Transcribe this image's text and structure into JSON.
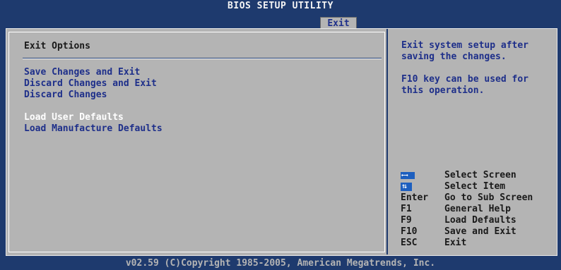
{
  "window": {
    "title": "BIOS SETUP UTILITY",
    "active_tab": "Exit"
  },
  "main": {
    "section_title": "Exit Options",
    "items": [
      {
        "label": "Save Changes and Exit"
      },
      {
        "label": "Discard Changes and Exit"
      },
      {
        "label": "Discard Changes"
      },
      {
        "label": "Load User Defaults",
        "selected": true
      },
      {
        "label": "Load Manufacture Defaults"
      }
    ]
  },
  "help": {
    "line1": "Exit system setup after saving the changes.",
    "line2": "F10 key can be used for this operation."
  },
  "keys": [
    {
      "key": "",
      "icon": "left-right-arrows-icon",
      "action": "Select Screen"
    },
    {
      "key": "",
      "icon": "up-down-arrows-icon",
      "action": "Select Item"
    },
    {
      "key": "Enter",
      "action": "Go to Sub Screen"
    },
    {
      "key": "F1",
      "action": "General Help"
    },
    {
      "key": "F9",
      "action": "Load Defaults"
    },
    {
      "key": "F10",
      "action": "Save and Exit"
    },
    {
      "key": "ESC",
      "action": "Exit"
    }
  ],
  "footer": {
    "copyright": "v02.59 (C)Copyright 1985-2005, American Megatrends, Inc."
  },
  "colors": {
    "background": "#1e3a6e",
    "panel": "#b4b4b4",
    "item_text": "#1e2f8a",
    "selected_text": "#ffffff"
  }
}
